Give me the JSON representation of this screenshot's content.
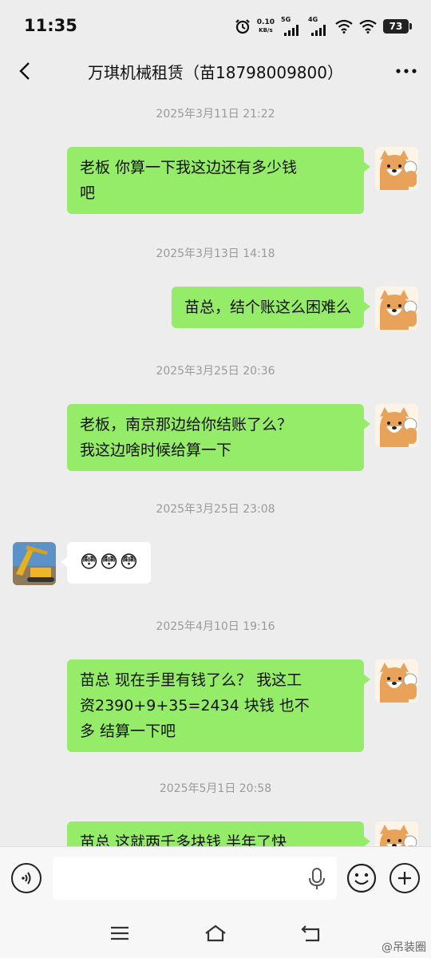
{
  "status_bar": {
    "time": "11:35",
    "net_speed_value": "0.10",
    "net_speed_unit": "KB/s",
    "net1": "5G",
    "net2": "4G",
    "battery": "73"
  },
  "header": {
    "title": "万琪机械租赁（苗18798009800）",
    "back_icon": "chevron-left-icon",
    "more_icon": "more-dots-icon"
  },
  "messages": [
    {
      "time": "2025年3月11日 21:22",
      "sender": "me",
      "line1": "老板  你算一下我这边还有多少钱",
      "line2": "吧"
    },
    {
      "time": "2025年3月13日 14:18",
      "sender": "me",
      "line1": "苗总，结个账这么困难么"
    },
    {
      "time": "2025年3月25日 20:36",
      "sender": "me",
      "line1": "老板，南京那边给你结账了么？",
      "line2": "我这边啥时候给算一下"
    },
    {
      "time": "2025年3月25日 23:08",
      "sender": "other",
      "emoji": [
        "😳",
        "😳",
        "😳"
      ]
    },
    {
      "time": "2025年4月10日 19:16",
      "sender": "me",
      "line1": "苗总   现在手里有钱了么？ 我这工",
      "line2": "资2390+9+35=2434 块钱   也不",
      "line3": "多  结算一下吧"
    },
    {
      "time": "2025年5月1日 20:58",
      "sender": "me",
      "line1": "苗总   这就两千多块钱  半年了快"
    }
  ],
  "input_bar": {
    "placeholder": "",
    "voice_icon": "voice-icon",
    "mic_icon": "microphone-icon",
    "emoji_icon": "emoji-smile-icon",
    "plus_icon": "plus-icon"
  },
  "nav_bar": {
    "menu_icon": "menu-icon",
    "home_icon": "home-icon",
    "back_icon": "back-icon"
  },
  "watermark": "@吊装圈"
}
